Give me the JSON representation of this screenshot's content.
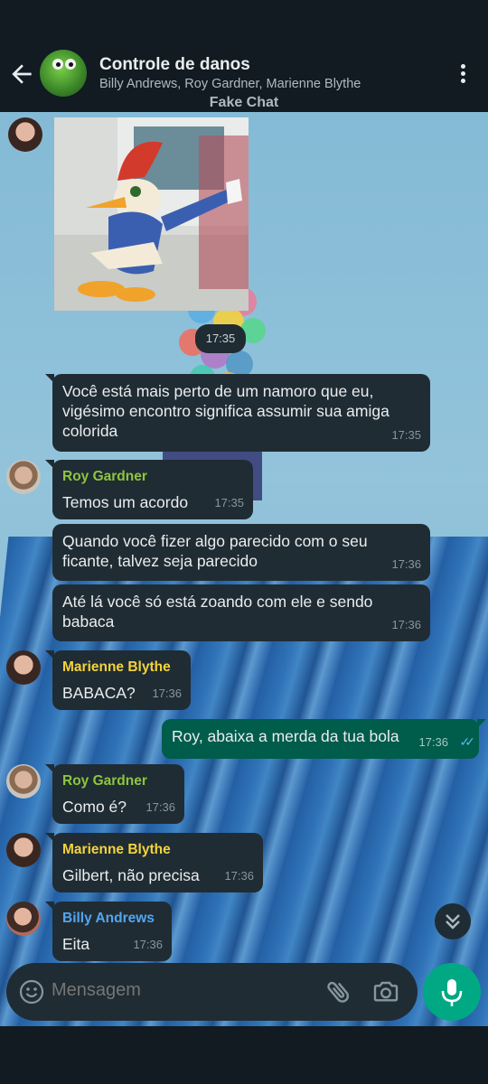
{
  "header": {
    "title": "Controle de danos",
    "members": "Billy Andrews, Roy Gardner, Marienne Blythe",
    "label": "Fake Chat"
  },
  "image_message": {
    "time": "17:35"
  },
  "messages": [
    {
      "sender": "",
      "text": "Você está mais perto de um namoro que eu, vigésimo encontro significa assumir sua amiga colorida",
      "time": "17:35"
    },
    {
      "sender": "Roy Gardner",
      "text": "Temos um acordo",
      "time": "17:35"
    },
    {
      "sender": "",
      "text": "Quando você fizer algo parecido com o seu ficante, talvez seja parecido",
      "time": "17:36"
    },
    {
      "sender": "",
      "text": "Até lá você só está zoando com ele e sendo babaca",
      "time": "17:36"
    },
    {
      "sender": "Marienne Blythe",
      "text": "BABACA?",
      "time": "17:36"
    },
    {
      "sender": "me",
      "text": "Roy, abaixa a merda da tua bola",
      "time": "17:36"
    },
    {
      "sender": "Roy Gardner",
      "text": "Como é?",
      "time": "17:36"
    },
    {
      "sender": "Marienne Blythe",
      "text": "Gilbert, não precisa",
      "time": "17:36"
    },
    {
      "sender": "Billy Andrews",
      "text": "Eita",
      "time": "17:36"
    }
  ],
  "colors": {
    "roy": "#8cc63f",
    "marienne": "#f3d33c",
    "billy": "#53a6f0",
    "outgoing_bubble": "#005c4b",
    "incoming_bubble": "#202c33",
    "mic_button": "#00a884"
  },
  "composer": {
    "placeholder": "Mensagem"
  },
  "icons": [
    "back-arrow-icon",
    "more-vert-icon",
    "emoji-icon",
    "attach-icon",
    "camera-icon",
    "mic-icon",
    "chevron-double-down-icon",
    "double-check-icon"
  ]
}
